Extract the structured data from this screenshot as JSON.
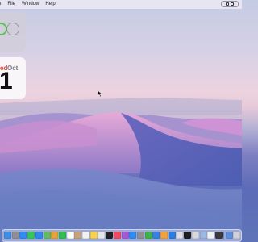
{
  "menubar": {
    "items": [
      "o",
      "File",
      "Window",
      "Help"
    ]
  },
  "widgets": {
    "battery": {
      "icon": "battery-ring-icon"
    },
    "calendar": {
      "weekday": "ed",
      "month": "Oct",
      "day": "1"
    }
  },
  "dock": {
    "apps": [
      {
        "name": "finder-icon",
        "color": "#3b8fe8"
      },
      {
        "name": "launchpad-icon",
        "color": "#8e8e96"
      },
      {
        "name": "safari-icon",
        "color": "#2f8cf0"
      },
      {
        "name": "messages-icon",
        "color": "#33c759"
      },
      {
        "name": "mail-icon",
        "color": "#2e88ee"
      },
      {
        "name": "maps-icon",
        "color": "#64b964"
      },
      {
        "name": "photos-icon",
        "color": "#e8a23a"
      },
      {
        "name": "facetime-icon",
        "color": "#2fbf4f"
      },
      {
        "name": "calendar-icon",
        "color": "#ffffff"
      },
      {
        "name": "contacts-icon",
        "color": "#c8a27c"
      },
      {
        "name": "reminders-icon",
        "color": "#f2f2f2"
      },
      {
        "name": "notes-icon",
        "color": "#f7d24b"
      },
      {
        "name": "freeform-icon",
        "color": "#e6e6ea"
      },
      {
        "name": "tv-icon",
        "color": "#222222"
      },
      {
        "name": "music-icon",
        "color": "#f04a5c"
      },
      {
        "name": "podcasts-icon",
        "color": "#a45ad8"
      },
      {
        "name": "appstore-icon",
        "color": "#2f8cf0"
      },
      {
        "name": "settings-icon",
        "color": "#8e8e96"
      },
      {
        "name": "numbers-icon",
        "color": "#3cb44b"
      },
      {
        "name": "keynote-icon",
        "color": "#3b7fe0"
      },
      {
        "name": "pages-icon",
        "color": "#f3a23a"
      },
      {
        "name": "xcode-icon",
        "color": "#2a7de1"
      },
      {
        "name": "iphone-mirroring-icon",
        "color": "#dddde2"
      },
      {
        "name": "terminal-icon",
        "color": "#1e1e1e"
      },
      {
        "name": "activity-monitor-icon",
        "color": "#d8d8dc"
      },
      {
        "name": "preview-icon",
        "color": "#9ab8e0"
      },
      {
        "name": "textedit-icon",
        "color": "#f0f0f0"
      },
      {
        "name": "calculator-icon",
        "color": "#3a3a3c"
      },
      {
        "name": "downloads-icon",
        "color": "#5d8fe0"
      },
      {
        "name": "trash-icon",
        "color": "#d0d0d6"
      }
    ]
  }
}
